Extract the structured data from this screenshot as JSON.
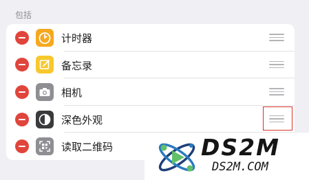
{
  "section": {
    "header": "包括"
  },
  "controls": [
    {
      "label": "计时器",
      "icon": "timer-icon",
      "icon_bg": "#f6a81f"
    },
    {
      "label": "备忘录",
      "icon": "notes-icon",
      "icon_bg": "#f7c82e"
    },
    {
      "label": "相机",
      "icon": "camera-icon",
      "icon_bg": "#8e8e93"
    },
    {
      "label": "深色外观",
      "icon": "dark-mode-icon",
      "icon_bg": "#3a3a3c"
    },
    {
      "label": "读取二维码",
      "icon": "qr-code-icon",
      "icon_bg": "#8e8e93"
    }
  ],
  "colors": {
    "remove_button": "#e0453c",
    "highlight": "#d8312a",
    "background": "#efeff4"
  },
  "watermark": {
    "brand": "DS2M",
    "url": "DS2M.COM"
  }
}
